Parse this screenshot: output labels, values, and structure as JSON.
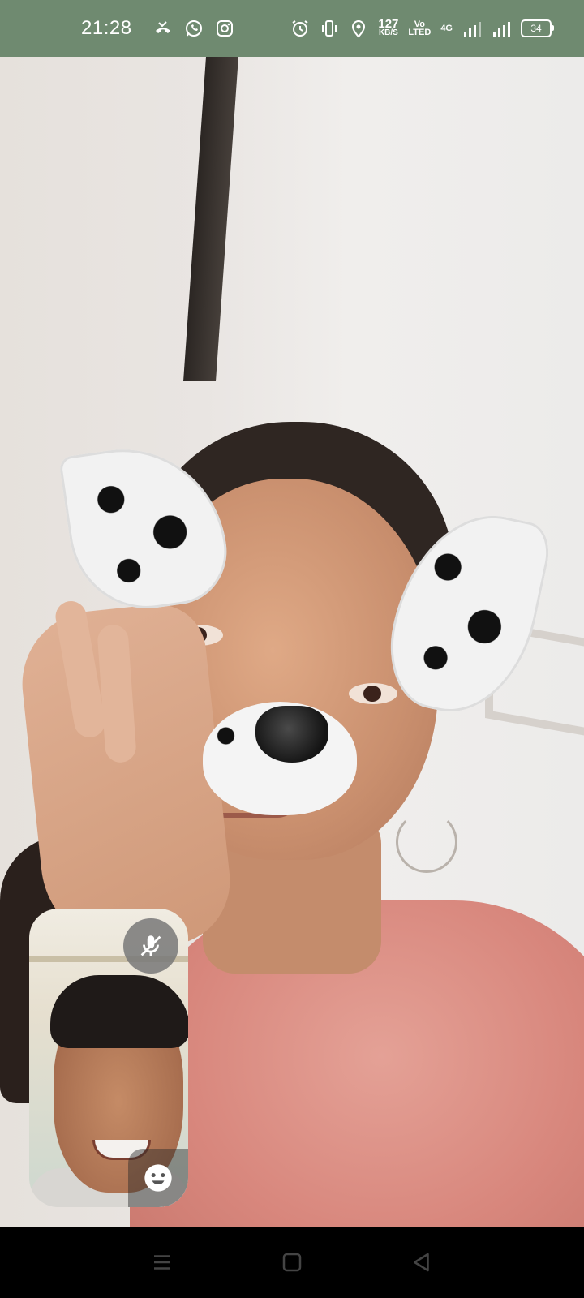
{
  "status_bar": {
    "time": "21:28",
    "notification_icons": [
      "missed-call-icon",
      "whatsapp-icon",
      "instagram-icon"
    ],
    "system_icons": [
      "alarm-icon",
      "vibrate-icon",
      "location-icon"
    ],
    "network_speed_value": "127",
    "network_speed_unit": "KB/S",
    "volte_top": "Vo",
    "volte_bottom": "LTED",
    "network_type": "4G",
    "battery_level": "34"
  },
  "call": {
    "remote_video": "remote-participant-video",
    "self_preview": "self-camera-preview",
    "controls": [
      "mute-icon",
      "smiley-icon"
    ]
  },
  "nav_bar": {
    "buttons": [
      "menu-icon",
      "home-icon",
      "back-icon"
    ]
  },
  "colors": {
    "status_bar_bg": "#6f8a70",
    "nav_bar_bg": "#000000"
  }
}
